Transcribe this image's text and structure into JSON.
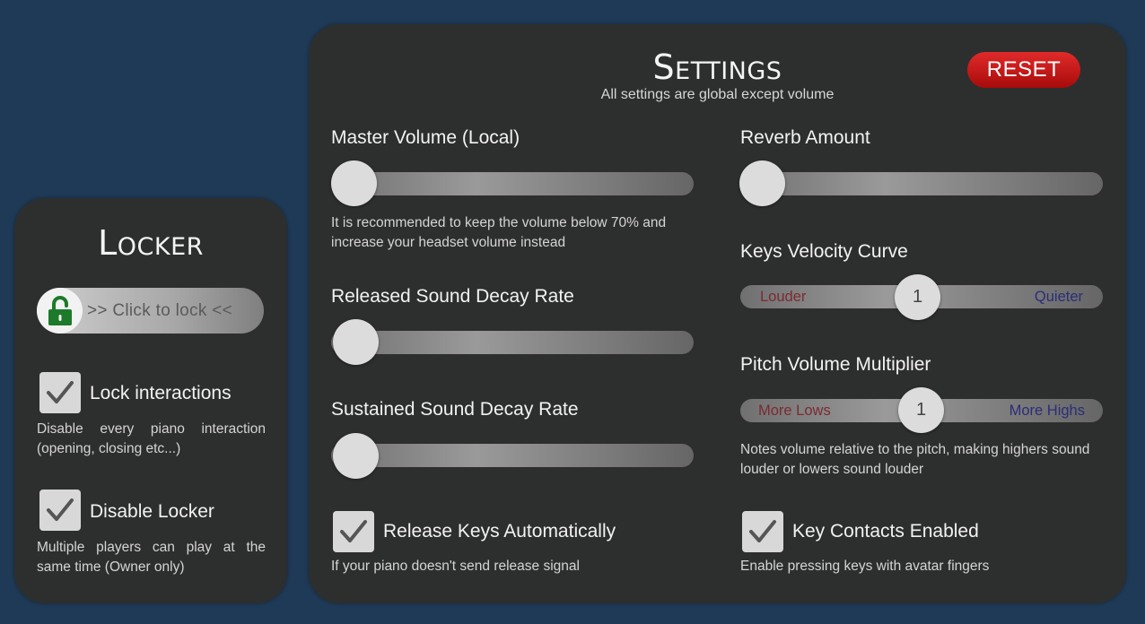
{
  "locker": {
    "title": "Locker",
    "lock_button_label": ">> Click to lock <<",
    "lock_icon": "unlocked-padlock-icon",
    "options": [
      {
        "label": "Lock interactions",
        "checked": true,
        "description": "Disable every piano interaction (opening, closing etc...)"
      },
      {
        "label": "Disable Locker",
        "checked": true,
        "description": "Multiple players can play at the same time (Owner only)"
      }
    ]
  },
  "settings": {
    "title": "Settings",
    "subtitle": "All settings are global except volume",
    "reset_label": "RESET",
    "master_volume": {
      "label": "Master Volume (Local)",
      "value": 0,
      "note": "It is recommended to keep the volume below 70% and increase your headset volume instead"
    },
    "released_decay": {
      "label": "Released Sound Decay Rate",
      "value": 0
    },
    "sustained_decay": {
      "label": "Sustained Sound Decay Rate",
      "value": 0
    },
    "release_keys": {
      "label": "Release Keys Automatically",
      "checked": true,
      "description": "If your piano doesn't send release signal"
    },
    "reverb": {
      "label": "Reverb Amount",
      "value": 0
    },
    "velocity_curve": {
      "label": "Keys Velocity Curve",
      "value": "1",
      "left_label": "Louder",
      "right_label": "Quieter"
    },
    "pitch_volume": {
      "label": "Pitch Volume Multiplier",
      "value": "1",
      "left_label": "More Lows",
      "right_label": "More Highs",
      "note": "Notes volume relative to the pitch, making highers sound louder or lowers sound louder"
    },
    "key_contacts": {
      "label": "Key Contacts Enabled",
      "checked": true,
      "description": "Enable pressing keys with avatar fingers"
    }
  },
  "colors": {
    "background": "#1f3a56",
    "panel": "#2d2f2e",
    "reset": "#c81414",
    "louder_text": "#7c2a31",
    "quieter_text": "#2b2d78"
  }
}
